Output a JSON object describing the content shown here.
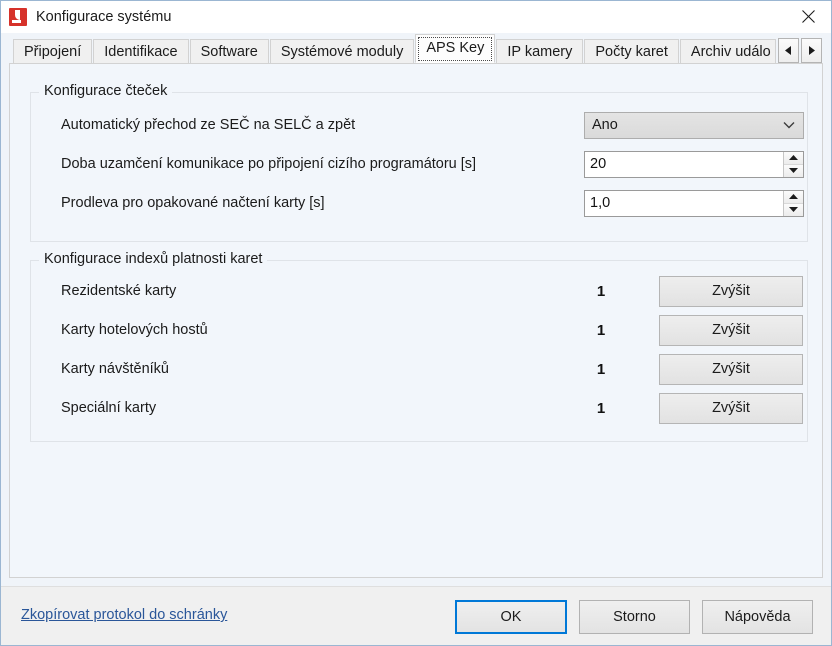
{
  "window": {
    "title": "Konfigurace systému",
    "app_icon": "aps-app-icon",
    "close_icon": "close-icon"
  },
  "tabs": {
    "items": [
      {
        "label": "Připojení",
        "active": false
      },
      {
        "label": "Identifikace",
        "active": false
      },
      {
        "label": "Software",
        "active": false
      },
      {
        "label": "Systémové moduly",
        "active": false
      },
      {
        "label": "APS Key",
        "active": true
      },
      {
        "label": "IP kamery",
        "active": false
      },
      {
        "label": "Počty karet",
        "active": false
      },
      {
        "label": "Archiv událo",
        "active": false
      }
    ],
    "scroll_left_icon": "chevron-left-icon",
    "scroll_right_icon": "chevron-right-icon"
  },
  "reader_group": {
    "title": "Konfigurace čteček",
    "rows": [
      {
        "label": "Automatický přechod ze SEČ na SELČ a zpět",
        "control": "combo",
        "value": "Ano",
        "chevron_icon": "chevron-down-icon"
      },
      {
        "label": "Doba uzamčení komunikace po připojení cizího programátoru [s]",
        "control": "spinner",
        "value": "20"
      },
      {
        "label": "Prodleva pro opakované načtení karty [s]",
        "control": "spinner",
        "value": "1,0"
      }
    ]
  },
  "index_group": {
    "title": "Konfigurace indexů platnosti karet",
    "rows": [
      {
        "label": "Rezidentské karty",
        "value": "1",
        "button": "Zvýšit"
      },
      {
        "label": "Karty hotelových hostů",
        "value": "1",
        "button": "Zvýšit"
      },
      {
        "label": "Karty návštěníků",
        "value": "1",
        "button": "Zvýšit"
      },
      {
        "label": "Speciální karty",
        "value": "1",
        "button": "Zvýšit"
      }
    ]
  },
  "footer": {
    "copy_link": "Zkopírovat protokol do schránky",
    "ok": "OK",
    "cancel": "Storno",
    "help": "Nápověda"
  },
  "colors": {
    "accent": "#0078d7",
    "link": "#2a5699",
    "app_icon": "#d6322a",
    "panel_bg": "#f2f6fb"
  }
}
